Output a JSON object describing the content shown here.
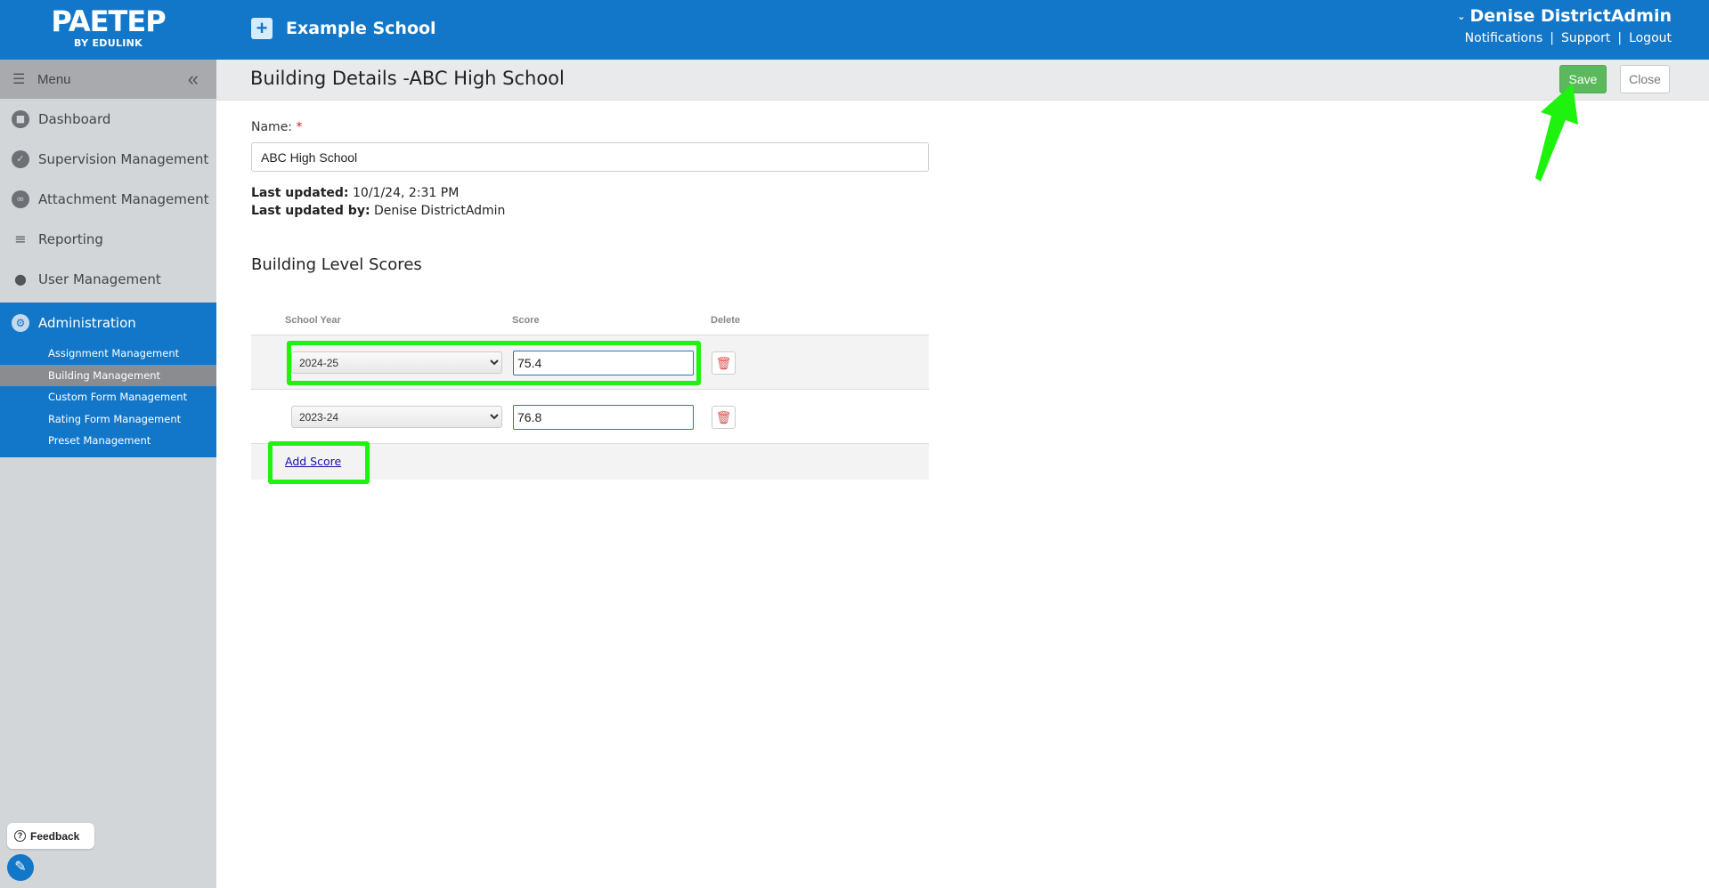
{
  "header": {
    "brand": "PAETEP",
    "brand_sub": "BY EDULINK",
    "school_name": "Example School",
    "user_name": "Denise DistrictAdmin",
    "links": [
      "Notifications",
      "Support",
      "Logout"
    ]
  },
  "sidebar": {
    "menu_label": "Menu",
    "items": [
      {
        "label": "Dashboard",
        "icon": "dashboard-icon"
      },
      {
        "label": "Supervision Management",
        "icon": "check-circle-icon"
      },
      {
        "label": "Attachment Management",
        "icon": "paperclip-icon"
      },
      {
        "label": "Reporting",
        "icon": "chart-icon"
      },
      {
        "label": "User Management",
        "icon": "user-icon"
      }
    ],
    "admin_label": "Administration",
    "sub_items": [
      {
        "label": "Assignment Management",
        "active": false
      },
      {
        "label": "Building Management",
        "active": true
      },
      {
        "label": "Custom Form Management",
        "active": false
      },
      {
        "label": "Rating Form Management",
        "active": false
      },
      {
        "label": "Preset Management",
        "active": false
      }
    ],
    "feedback_label": "Feedback"
  },
  "page": {
    "title": "Building Details -ABC High School",
    "save_label": "Save",
    "close_label": "Close",
    "name_label": "Name:",
    "required_mark": "*",
    "name_value": "ABC High School",
    "last_updated_label": "Last updated:",
    "last_updated_value": "10/1/24, 2:31 PM",
    "last_updated_by_label": "Last updated by:",
    "last_updated_by_value": "Denise DistrictAdmin",
    "section_title": "Building Level Scores",
    "columns": [
      "School Year",
      "Score",
      "Delete"
    ],
    "scores": [
      {
        "year": "2024-25",
        "score": "75.4"
      },
      {
        "year": "2023-24",
        "score": "76.8"
      }
    ],
    "add_score_label": "Add Score"
  },
  "colors": {
    "primary": "#1277c8",
    "highlight": "#1ef20f",
    "save_green": "#5cb85c"
  }
}
